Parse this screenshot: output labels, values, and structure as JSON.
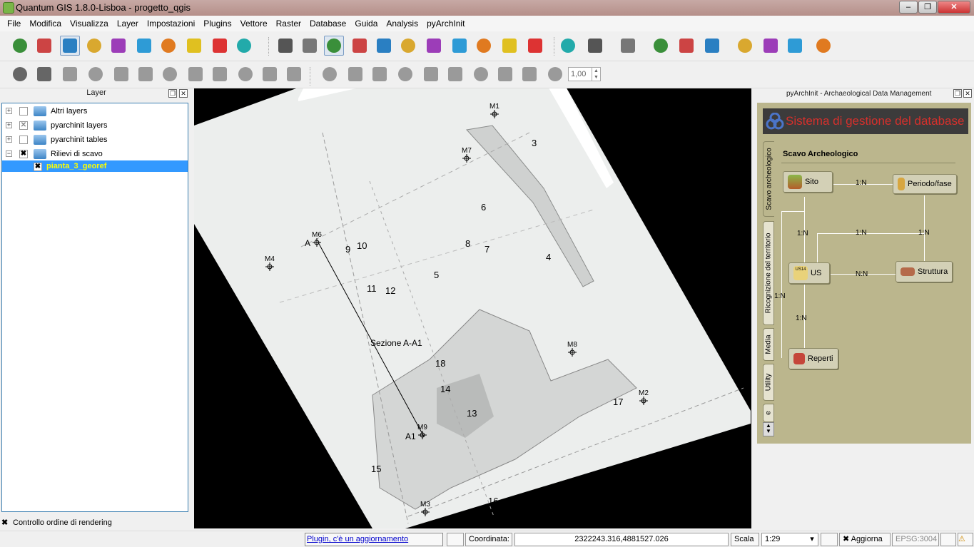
{
  "window": {
    "title": "Quantum GIS 1.8.0-Lisboa - progetto_qgis",
    "minimize": "–",
    "maximize": "❐",
    "close": "✕"
  },
  "menu": [
    "File",
    "Modifica",
    "Visualizza",
    "Layer",
    "Impostazioni",
    "Plugins",
    "Vettore",
    "Raster",
    "Database",
    "Guida",
    "Analysis",
    "pyArchInit"
  ],
  "toolbar1_icons": [
    "new-shapefile-icon",
    "add-raster-icon",
    "add-database-icon",
    "add-spatialite-icon",
    "add-postgis-icon",
    "add-wms-icon",
    "add-wfs-icon",
    "favorite-icon",
    "remove-layer-icon",
    "new-layer-icon",
    "pan-icon",
    "pan-to-selection-icon",
    "zoom-in-icon",
    "zoom-out-icon",
    "zoom-actual-icon",
    "zoom-full-icon",
    "zoom-layer-icon",
    "zoom-selection-icon",
    "zoom-last-icon",
    "zoom-next-icon",
    "refresh-icon",
    "identify-icon",
    "action-icon",
    "select-icon",
    "deselect-icon",
    "attribute-table-icon",
    "measure-icon",
    "annotation-icon",
    "home-icon",
    "home2-icon",
    "text-icon"
  ],
  "toolbar2_icons": [
    "undo-icon",
    "redo-icon",
    "move-feature-icon",
    "add-ring-icon",
    "add-part-icon",
    "delete-ring-icon",
    "delete-part-icon",
    "reshape-icon",
    "offset-curve-icon",
    "simplify-icon",
    "fill-ring-icon",
    "rotate-icon",
    "edit-icon",
    "save-edits-icon",
    "add-point-icon",
    "node-tool-icon",
    "vertex-icon",
    "delete-selected-icon",
    "cut-icon",
    "copy-icon",
    "paste-icon",
    "snap-icon"
  ],
  "spin_value": "1,00",
  "layers_panel": {
    "title": "Layer",
    "items": [
      {
        "label": "Altri layers",
        "expander": "+",
        "checked": ""
      },
      {
        "label": "pyarchinit layers",
        "expander": "+",
        "checked": "✕"
      },
      {
        "label": "pyarchinit tables",
        "expander": "+",
        "checked": ""
      },
      {
        "label": "Rilievi di scavo",
        "expander": "−",
        "checked": "✖"
      }
    ],
    "selected": {
      "label": "pianta_3_georef",
      "checked": "✖"
    },
    "render_order": {
      "label": "Controllo ordine di rendering",
      "checked": "✖"
    }
  },
  "map": {
    "point_labels": [
      {
        "text": "M1"
      },
      {
        "text": "M2"
      },
      {
        "text": "M3"
      },
      {
        "text": "M4"
      },
      {
        "text": "M6"
      },
      {
        "text": "M7"
      },
      {
        "text": "M8"
      },
      {
        "text": "M9"
      }
    ],
    "feature_labels": [
      "3",
      "4",
      "5",
      "6",
      "7",
      "8",
      "9",
      "10",
      "11",
      "12",
      "13",
      "14",
      "15",
      "16",
      "17",
      "18"
    ],
    "section_label": "Sezione A-A1",
    "marker_a": "A",
    "marker_a1": "A1"
  },
  "pyarchinit": {
    "panel_title": "pyArchInit - Archaeological Data Management",
    "banner": "Sistema di gestione del database",
    "tabs": [
      "Scavo archeologico",
      "Ricognizione del territorio",
      "Media",
      "Utility",
      "e"
    ],
    "section_title": "Scavo Archeologico",
    "nodes": {
      "sito": "Sito",
      "periodo": "Periodo/fase",
      "us": "US",
      "struttura": "Struttura",
      "reperti": "Reperti"
    },
    "relations": {
      "sito_periodo": "1:N",
      "sito_us": "1:N",
      "us_periodo_mid": "1:N",
      "periodo_down": "1:N",
      "us_struttura": "N:N",
      "us_reperti": "1:N",
      "left": "1:N"
    },
    "us_badge": "US14"
  },
  "status": {
    "plugin_link": "Plugin, c'è un aggiornamento disponibile",
    "coord_label": "Coordinata:",
    "coord_value": "2322243.316,4881527.026",
    "scale_label": "Scala",
    "scale_value": "1:29",
    "update_label": "Aggiorna",
    "epsg": "EPSG:3004"
  }
}
